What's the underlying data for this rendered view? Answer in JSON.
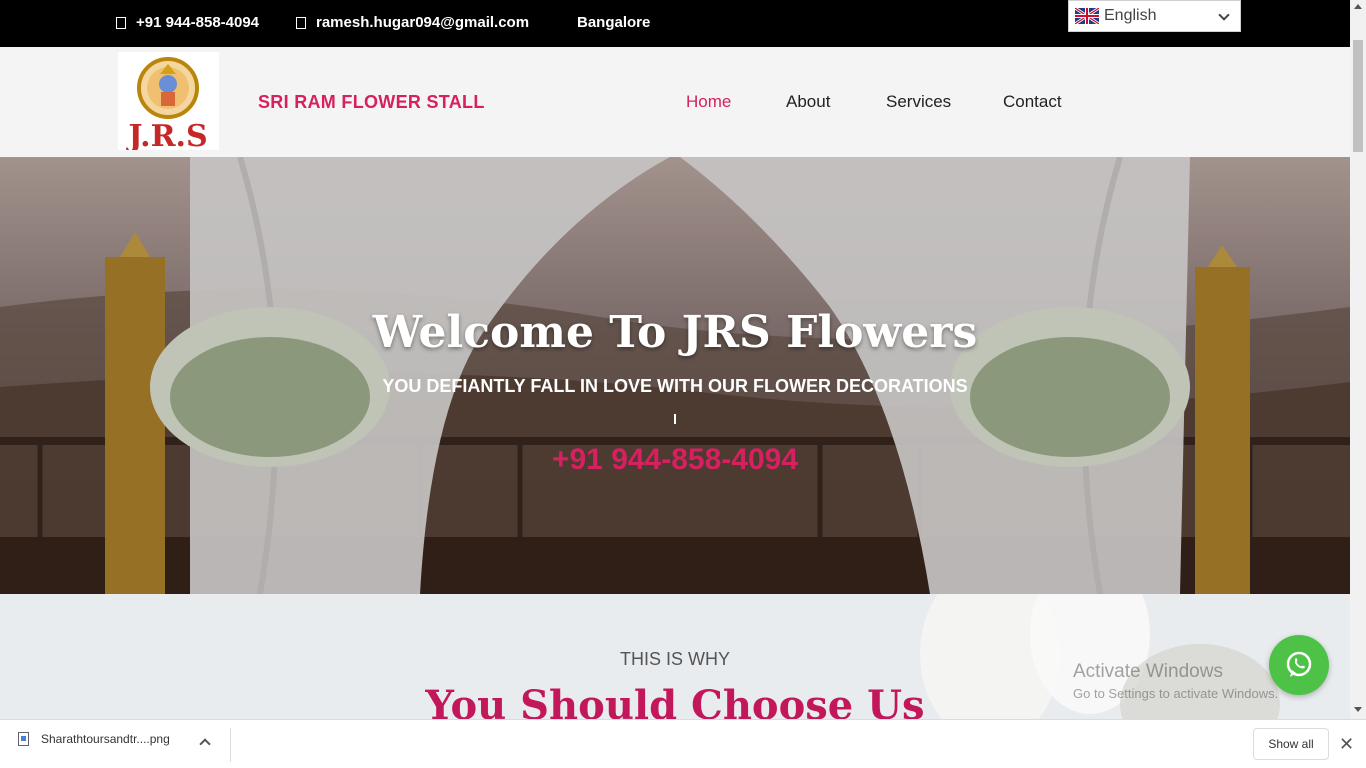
{
  "topbar": {
    "phone": "+91 944-858-4094",
    "email": "ramesh.hugar094@gmail.com",
    "location": "Bangalore",
    "language": "English",
    "phone_icon": "phone-icon",
    "email_icon": "envelope-icon"
  },
  "header": {
    "logo_text": "J.R.S",
    "brand": "SRI RAM FLOWER STALL",
    "nav": [
      "Home",
      "About",
      "Services",
      "Contact"
    ]
  },
  "hero": {
    "title": "Welcome To JRS Flowers",
    "subtitle": "YOU DEFIANTLY FALL IN LOVE WITH OUR FLOWER DECORATIONS",
    "phone": "+91 944-858-4094"
  },
  "why": {
    "label": "THIS IS WHY",
    "title": "You Should Choose Us"
  },
  "overlay": {
    "activate_title": "Activate Windows",
    "activate_sub": "Go to Settings to activate Windows."
  },
  "download_bar": {
    "file_name": "Sharathtoursandtr....png",
    "show_all": "Show all"
  },
  "colors": {
    "accent": "#d6205f",
    "whatsapp": "#4dc247"
  }
}
